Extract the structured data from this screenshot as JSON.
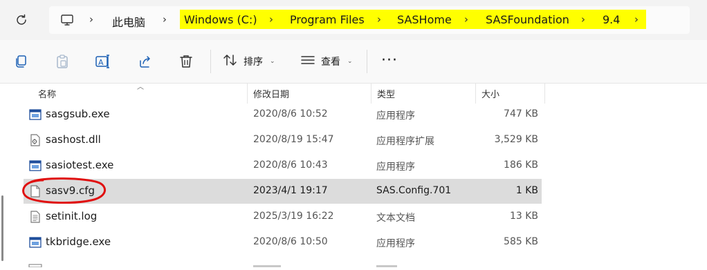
{
  "address_bar": {
    "root": "此电脑",
    "path": [
      "Windows (C:)",
      "Program Files",
      "SASHome",
      "SASFoundation",
      "9.4"
    ]
  },
  "toolbar": {
    "sort_label": "排序",
    "view_label": "查看",
    "more_label": "···"
  },
  "columns": {
    "name": "名称",
    "modified": "修改日期",
    "type": "类型",
    "size": "大小"
  },
  "files": [
    {
      "name": "sasgsub.exe",
      "modified": "2020/8/6 10:52",
      "type": "应用程序",
      "size": "747 KB",
      "icon": "exe-icon"
    },
    {
      "name": "sashost.dll",
      "modified": "2020/8/19 15:47",
      "type": "应用程序扩展",
      "size": "3,529 KB",
      "icon": "dll-icon"
    },
    {
      "name": "sasiotest.exe",
      "modified": "2020/8/6 10:43",
      "type": "应用程序",
      "size": "186 KB",
      "icon": "exe-icon"
    },
    {
      "name": "sasv9.cfg",
      "modified": "2023/4/1 19:17",
      "type": "SAS.Config.701",
      "size": "1 KB",
      "icon": "cfg-file-icon",
      "selected": true
    },
    {
      "name": "setinit.log",
      "modified": "2025/3/19 16:22",
      "type": "文本文档",
      "size": "13 KB",
      "icon": "text-file-icon"
    },
    {
      "name": "tkbridge.exe",
      "modified": "2020/8/6 10:50",
      "type": "应用程序",
      "size": "585 KB",
      "icon": "exe-icon"
    }
  ],
  "colors": {
    "path_highlight": "#ffff00",
    "selection": "#dcdcdc",
    "annotation_circle": "#e01010",
    "exe_icon_blue": "#1f4e9c"
  }
}
